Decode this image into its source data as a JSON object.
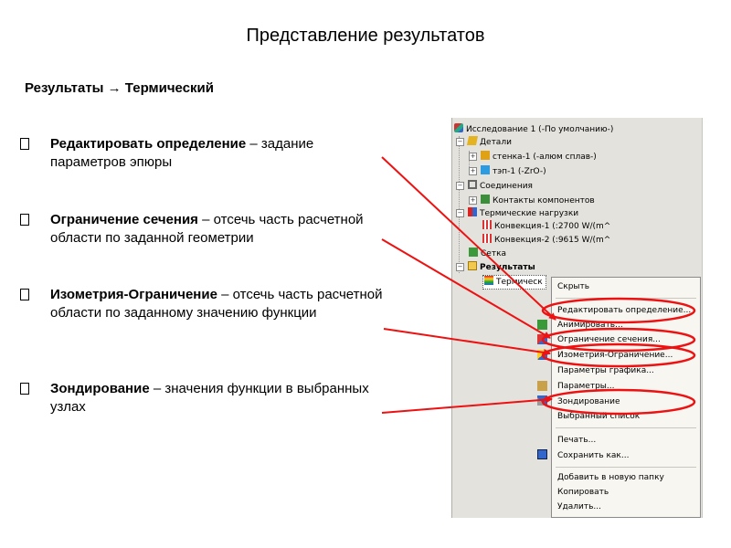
{
  "title": "Представление результатов",
  "subtitle": "Результаты → Термический",
  "bullets": [
    {
      "term": "Редактировать определение",
      "desc": " – задание параметров эпюры"
    },
    {
      "term": "Ограничение сечения",
      "desc": " – отсечь часть расчетной области по заданной геометрии"
    },
    {
      "term": "Изометрия-Ограничение",
      "desc": " – отсечь часть расчетной области по заданному значению функции"
    },
    {
      "term": "Зондирование",
      "desc": " – значения функции в выбранных узлах"
    }
  ],
  "tree": {
    "study": "Исследование 1 (-По умолчанию-)",
    "parts": "Детали",
    "part1": "стенка-1 (-алюм сплав-)",
    "part2": "тэп-1 (-ZrO-)",
    "connections": "Соединения",
    "contacts": "Контакты компонентов",
    "thermal_loads": "Термические нагрузки",
    "conv1": "Конвекция-1 (:2700 W/(m^",
    "conv2": "Конвекция-2 (:9615 W/(m^",
    "mesh": "Сетка",
    "results": "Результаты",
    "thermal": "Термическ"
  },
  "menu": {
    "hide": "Скрыть",
    "edit_definition": "Редактировать определение...",
    "animate": "Анимировать...",
    "section_clipping": "Ограничение сечения...",
    "iso_clipping": "Изометрия-Ограничение...",
    "plot_params": "Параметры графика...",
    "params": "Параметры...",
    "probe": "Зондирование",
    "selected_list": "Выбранный список",
    "print": "Печать...",
    "save_as": "Сохранить как...",
    "add_folder": "Добавить в новую папку",
    "copy": "Копировать",
    "delete": "Удалить..."
  },
  "colors": {
    "highlight": "#ee1111",
    "tree_bg": "#e4e2dd",
    "menu_bg": "#f7f6f1"
  }
}
